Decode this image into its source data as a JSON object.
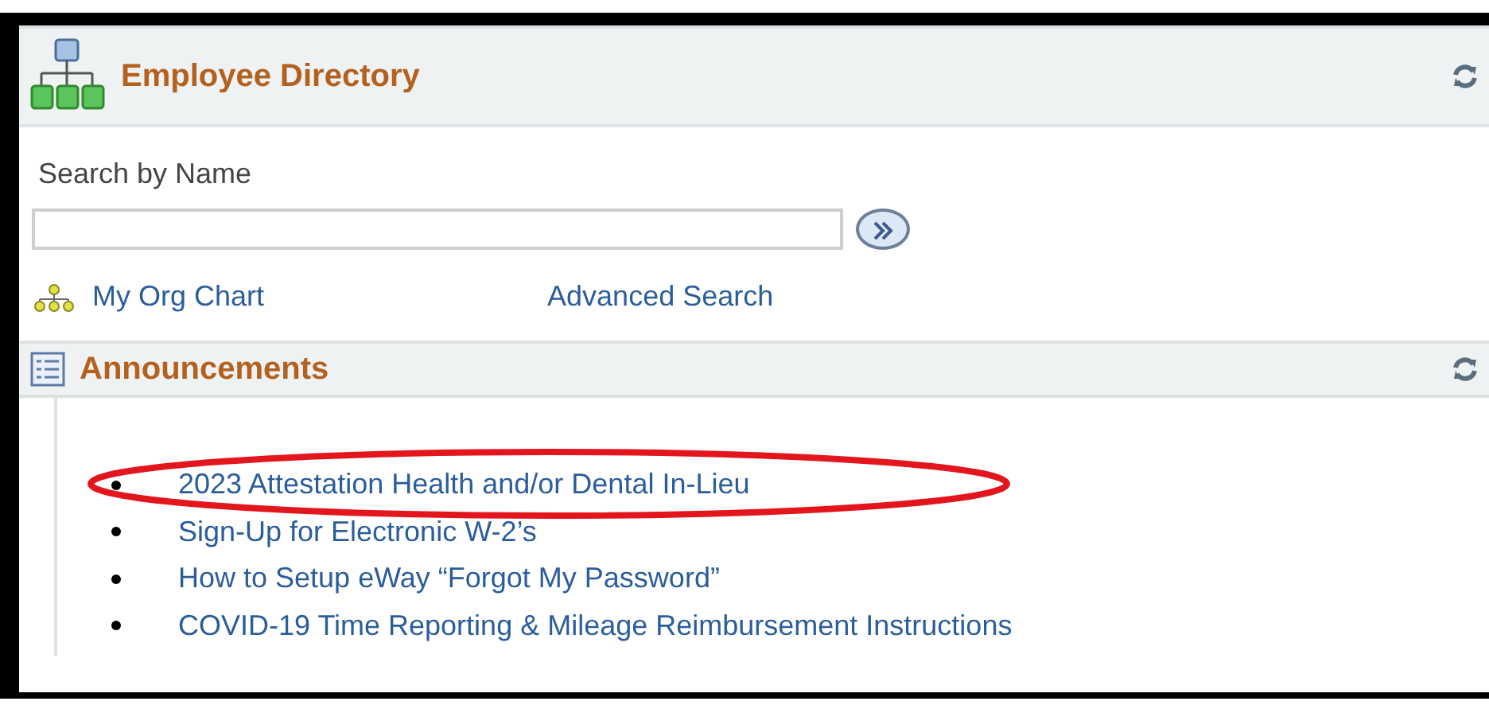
{
  "directory": {
    "title": "Employee Directory",
    "search_label": "Search by Name",
    "links": [
      {
        "kind": "org",
        "label": "My Org Chart"
      },
      {
        "kind": "plain",
        "label": "Advanced Search"
      }
    ]
  },
  "announcements": {
    "title": "Announcements",
    "items": [
      {
        "text": "2023 Attestation Health and/or Dental In-Lieu",
        "circled": true
      },
      {
        "text": "Sign-Up for Electronic W-2’s",
        "circled": false
      },
      {
        "text": "How to Setup eWay “Forgot My Password”",
        "circled": false
      },
      {
        "text": "COVID-19 Time Reporting & Mileage Reimbursement Instructions",
        "circled": false
      }
    ]
  }
}
